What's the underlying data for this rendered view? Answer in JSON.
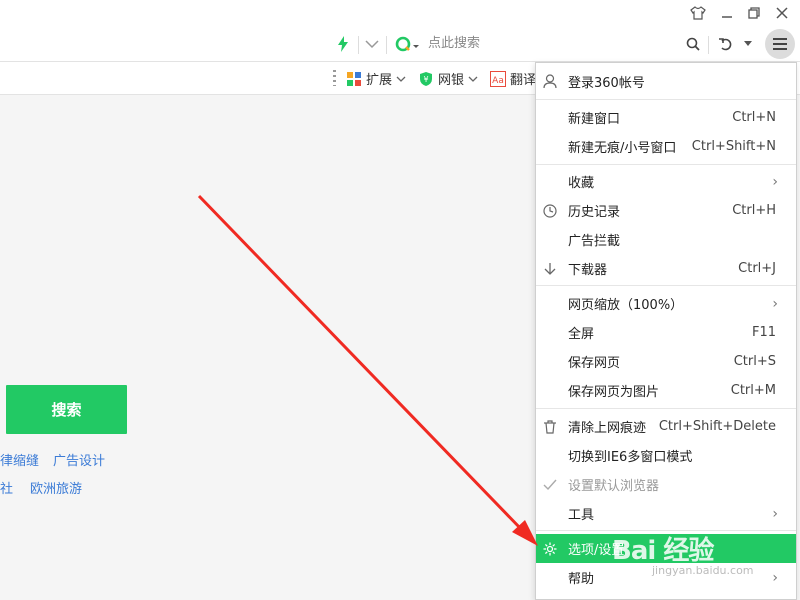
{
  "toolbar": {
    "search_placeholder": "点此搜索"
  },
  "bookmarks": {
    "items": [
      {
        "label": "扩展"
      },
      {
        "label": "网银"
      },
      {
        "label": "翻译"
      }
    ]
  },
  "page": {
    "search_button": "搜索",
    "hot_links": [
      "律缩缝",
      "广告设计",
      "社",
      "欧洲旅游"
    ]
  },
  "menu": {
    "login": "登录360帐号",
    "items": [
      {
        "label": "新建窗口",
        "shortcut": "Ctrl+N"
      },
      {
        "label": "新建无痕/小号窗口",
        "shortcut": "Ctrl+Shift+N"
      },
      {
        "label": "收藏"
      },
      {
        "label": "历史记录",
        "shortcut": "Ctrl+H"
      },
      {
        "label": "广告拦截"
      },
      {
        "label": "下载器",
        "shortcut": "Ctrl+J"
      },
      {
        "label": "网页缩放（100%）"
      },
      {
        "label": "全屏",
        "shortcut": "F11"
      },
      {
        "label": "保存网页",
        "shortcut": "Ctrl+S"
      },
      {
        "label": "保存网页为图片",
        "shortcut": "Ctrl+M"
      },
      {
        "label": "清除上网痕迹",
        "shortcut": "Ctrl+Shift+Delete"
      },
      {
        "label": "切换到IE6多窗口模式"
      },
      {
        "label": "设置默认浏览器"
      },
      {
        "label": "工具"
      },
      {
        "label": "选项/设置"
      },
      {
        "label": "帮助"
      }
    ]
  },
  "watermark": {
    "main": "Bai 经验",
    "sub": "jingyan.baidu.com"
  },
  "colors": {
    "accent": "#22c964",
    "arrow": "#f02a22",
    "link": "#3b7bd6"
  }
}
